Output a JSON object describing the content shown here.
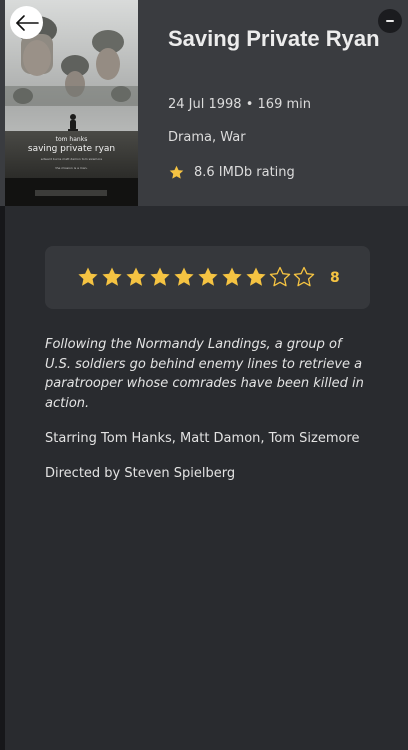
{
  "movie": {
    "title": "Saving Private Ryan",
    "release_date": "24 Jul 1998",
    "separator": "•",
    "runtime": "169 min",
    "genres": "Drama, War",
    "imdb_rating_text": "8.6 IMDb rating"
  },
  "poster": {
    "actor": "tom hanks",
    "title": "saving private ryan",
    "credits": "edward burns  matt damon  tom sizemore",
    "tagline": "the mission is a man."
  },
  "user_rating": {
    "value": 8,
    "max": 10,
    "display": "8"
  },
  "details": {
    "overview": "Following the Normandy Landings, a group of U.S. soldiers go behind enemy lines to retrieve a paratrooper whose comrades have been killed in action.",
    "starring": "Starring Tom Hanks, Matt Damon, Tom Sizemore",
    "directed": "Directed by Steven Spielberg"
  },
  "icons": {
    "back": "arrow-left-icon",
    "minimize": "minus-icon",
    "imdb": "star-icon",
    "rating_full": "star-filled-icon",
    "rating_empty": "star-outline-icon"
  },
  "colors": {
    "background": "#292b2f",
    "header": "#3a3c40",
    "card": "#36383c",
    "star": "#f5c342",
    "text": "#e3e3e3"
  }
}
